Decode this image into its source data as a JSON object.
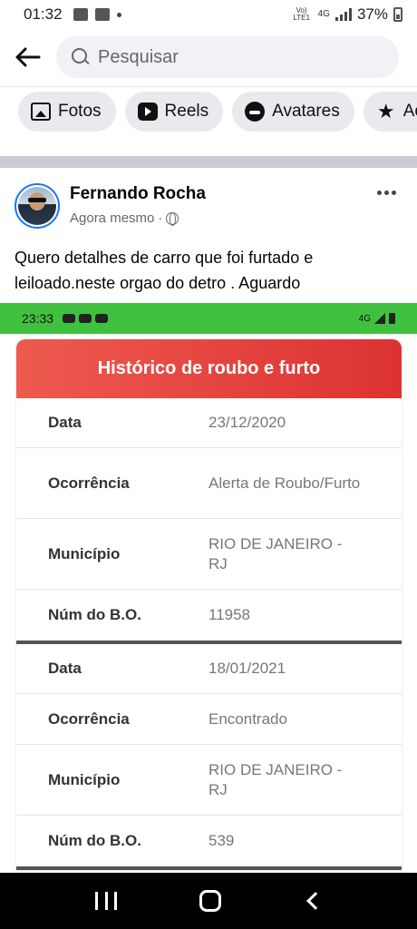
{
  "status_bar": {
    "time": "01:32",
    "network": "4G",
    "volte": "Vo) LTE1",
    "battery": "37%"
  },
  "search": {
    "placeholder": "Pesquisar"
  },
  "chips": [
    {
      "label": "Fotos",
      "icon": "photos-icon"
    },
    {
      "label": "Reels",
      "icon": "reels-icon"
    },
    {
      "label": "Avatares",
      "icon": "avatar-icon"
    },
    {
      "label": "Ac",
      "icon": "star-icon"
    }
  ],
  "post": {
    "author": "Fernando Rocha",
    "timestamp": "Agora mesmo",
    "separator": "·",
    "text": "Quero detalhes de carro que foi furtado e leiloado.neste orgao do detro . Aguardo"
  },
  "embedded_screenshot": {
    "status_time": "23:33",
    "status_network": "4G",
    "title": "Histórico de roubo e furto",
    "records": [
      {
        "data_label": "Data",
        "data_value": "23/12/2020",
        "ocorrencia_label": "Ocorrência",
        "ocorrencia_value": "Alerta de Roubo/Furto",
        "municipio_label": "Município",
        "municipio_value": "RIO DE JANEIRO - RJ",
        "bo_label": "Núm do B.O.",
        "bo_value": "11958"
      },
      {
        "data_label": "Data",
        "data_value": "18/01/2021",
        "ocorrencia_label": "Ocorrência",
        "ocorrencia_value": "Encontrado",
        "municipio_label": "Município",
        "municipio_value": "RIO DE JANEIRO - RJ",
        "bo_label": "Núm do B.O.",
        "bo_value": "539"
      }
    ]
  },
  "colors": {
    "header_red": "#dc3232",
    "status_green": "#3fc13f",
    "facebook_blue": "#1877f2"
  }
}
